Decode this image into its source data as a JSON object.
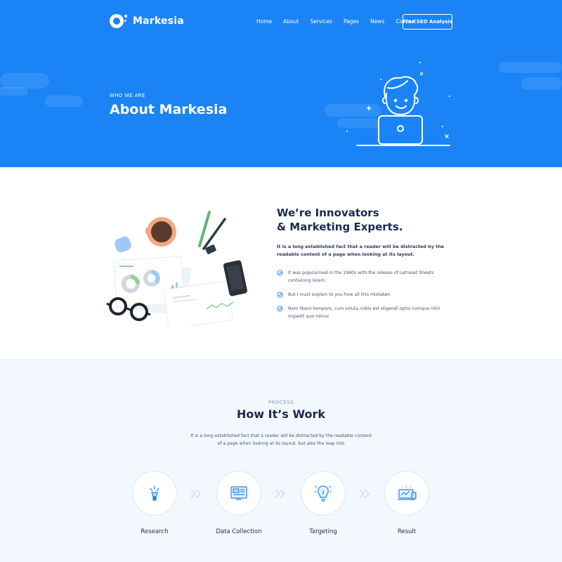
{
  "brand": {
    "name": "Markesia",
    "primary_color": "#1a84f6",
    "dark_text": "#1b2a4e"
  },
  "nav": {
    "links": [
      "Home",
      "About",
      "Services",
      "Pages",
      "News",
      "Contact"
    ],
    "cta": "Free SEO Analysis"
  },
  "hero": {
    "eyebrow": "WHO WE ARE",
    "title": "About Markesia",
    "illustration": "person-with-laptop-icon"
  },
  "about": {
    "title_line1": "We’re Innovators",
    "title_line2": "& Marketing Experts.",
    "lead": "It is a long established fact that a reader will be distracted by the readable content of a page when looking at its layout.",
    "checklist": [
      "It was popularised in the 1960s with the release of Letraset Sheets containing lorem.",
      "But I must explain to you how all this mistaken",
      " Nam libero tempore, cum soluta nobis est eligendi optio cumque nihil impedit quo minus"
    ],
    "illustration": "desk-workspace-icon"
  },
  "process": {
    "eyebrow": "PROCESS",
    "title": "How It’s Work",
    "description": "It is a long established fact that a reader will be distracted by the readable content of a page when looking at its layout.  but also the leap into",
    "steps": [
      {
        "label": "Research",
        "icon": "research-icon"
      },
      {
        "label": "Data Collection",
        "icon": "data-collection-icon"
      },
      {
        "label": "Targeting",
        "icon": "targeting-icon"
      },
      {
        "label": "Result",
        "icon": "result-icon"
      }
    ]
  }
}
